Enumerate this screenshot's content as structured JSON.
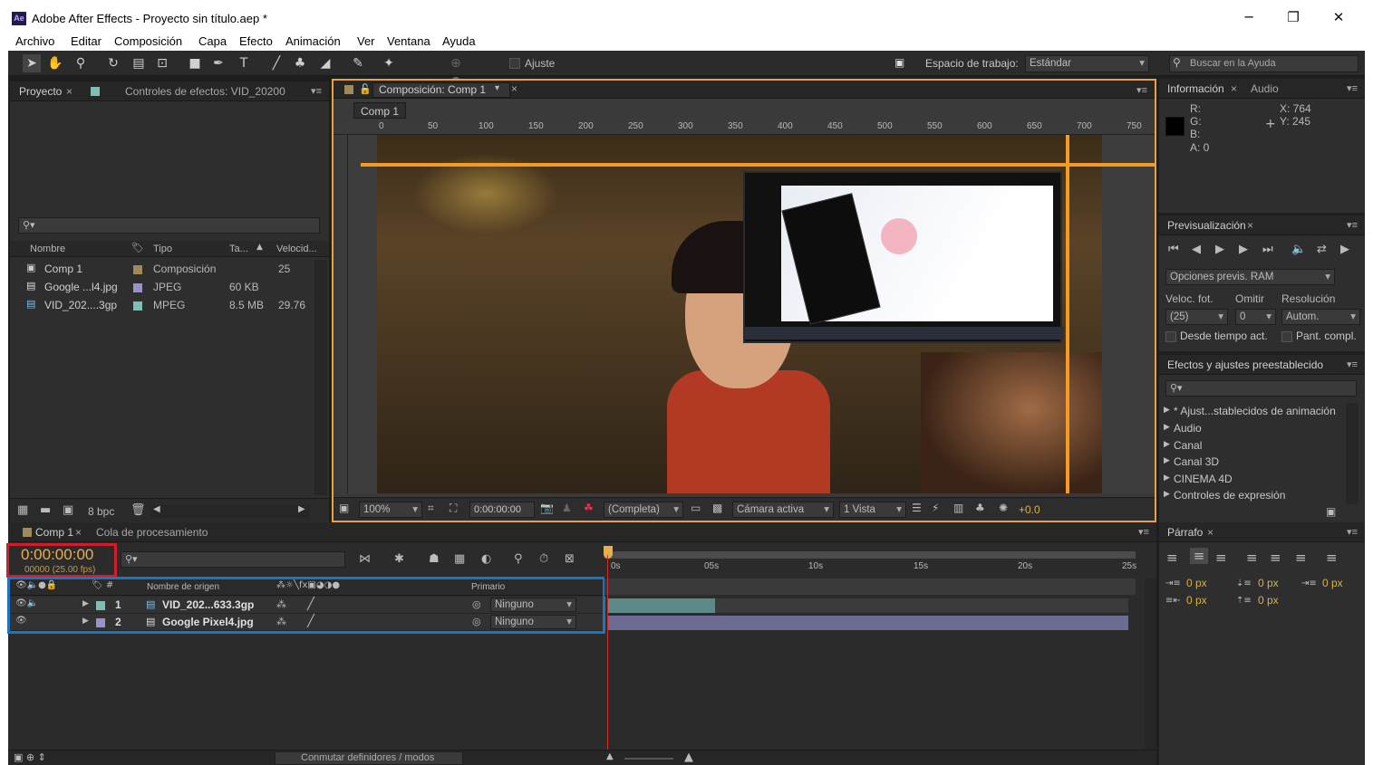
{
  "window": {
    "title": "Adobe After Effects - Proyecto sin título.aep *",
    "app_icon": "Ae",
    "controls": [
      "minimize-icon",
      "restore-icon",
      "close-icon"
    ]
  },
  "menu": [
    "Archivo",
    "Editar",
    "Composición",
    "Capa",
    "Efecto",
    "Animación",
    "Ver",
    "Ventana",
    "Ayuda"
  ],
  "toolbar": {
    "snap_label": "Ajuste",
    "workspace_label": "Espacio de trabajo:",
    "workspace_value": "Estándar",
    "help_search_placeholder": "Buscar en la Ayuda"
  },
  "project_panel": {
    "tabs": [
      "Proyecto",
      "Controles de efectos: VID_20200"
    ],
    "columns": [
      "Nombre",
      "Tipo",
      "Ta...",
      "Velocid..."
    ],
    "items": [
      {
        "name": "Comp 1",
        "type": "Composición",
        "size": "25",
        "speed": "",
        "label_color": "#a08a5a"
      },
      {
        "name": "Google ...l4.jpg",
        "type": "JPEG",
        "size": "60 KB",
        "speed": "",
        "label_color": "#9a92c4"
      },
      {
        "name": "VID_202....3gp",
        "type": "MPEG",
        "size": "8.5 MB",
        "speed": "29.76",
        "label_color": "#7fbfb3"
      }
    ],
    "bpc": "8 bpc"
  },
  "comp_panel": {
    "tab": "Composición: Comp 1",
    "breadcrumb": "Comp 1",
    "ruler_ticks": [
      "0",
      "50",
      "100",
      "150",
      "200",
      "250",
      "300",
      "350",
      "400",
      "450",
      "500",
      "550",
      "600",
      "650",
      "700",
      "750"
    ],
    "zoom": "100%",
    "timecode": "0:00:00:00",
    "resolution": "(Completa)",
    "camera": "Cámara activa",
    "view": "1 Vista",
    "exposure": "+0.0"
  },
  "info_panel": {
    "tabs": [
      "Información",
      "Audio"
    ],
    "r": "R:",
    "g": "G:",
    "b": "B:",
    "a": "A:  0",
    "x": "X:  764",
    "y": "Y:  245"
  },
  "preview_panel": {
    "tab": "Previsualización",
    "ram_options": "Opciones previs. RAM",
    "fps_label": "Veloc. fot.",
    "skip_label": "Omitir",
    "res_label": "Resolución",
    "fps_value": "(25)",
    "skip_value": "0",
    "res_value": "Autom.",
    "from_current": "Desde tiempo act.",
    "full_screen": "Pant. compl."
  },
  "effects_panel": {
    "tab": "Efectos y ajustes preestablecido",
    "items": [
      "* Ajust...stablecidos de animación",
      "Audio",
      "Canal",
      "Canal 3D",
      "CINEMA 4D",
      "Controles de expresión"
    ]
  },
  "timeline": {
    "tabs": [
      "Comp 1",
      "Cola de procesamiento"
    ],
    "timecode": "0:00:00:00",
    "frame_info": "00000 (25.00 fps)",
    "columns": {
      "source": "Nombre de origen",
      "parent": "Primario"
    },
    "time_labels": [
      "0s",
      "05s",
      "10s",
      "15s",
      "20s",
      "25s"
    ],
    "layers": [
      {
        "num": "1",
        "name": "VID_202...633.3gp",
        "parent": "Ninguno",
        "bar_color": "#5c8a86"
      },
      {
        "num": "2",
        "name": "Google Pixel4.jpg",
        "parent": "Ninguno",
        "bar_color": "#6d6a94"
      }
    ],
    "footer": "Conmutar definidores / modos"
  },
  "paragraph_panel": {
    "tab": "Párrafo",
    "px_values": [
      "0 px",
      "0 px",
      "0 px",
      "0 px",
      "0 px"
    ]
  },
  "colors": {
    "accent_orange": "#f59a23",
    "highlight_red": "#d01c2d",
    "highlight_blue": "#1b76c2",
    "timecode_yellow": "#e8b04a"
  }
}
